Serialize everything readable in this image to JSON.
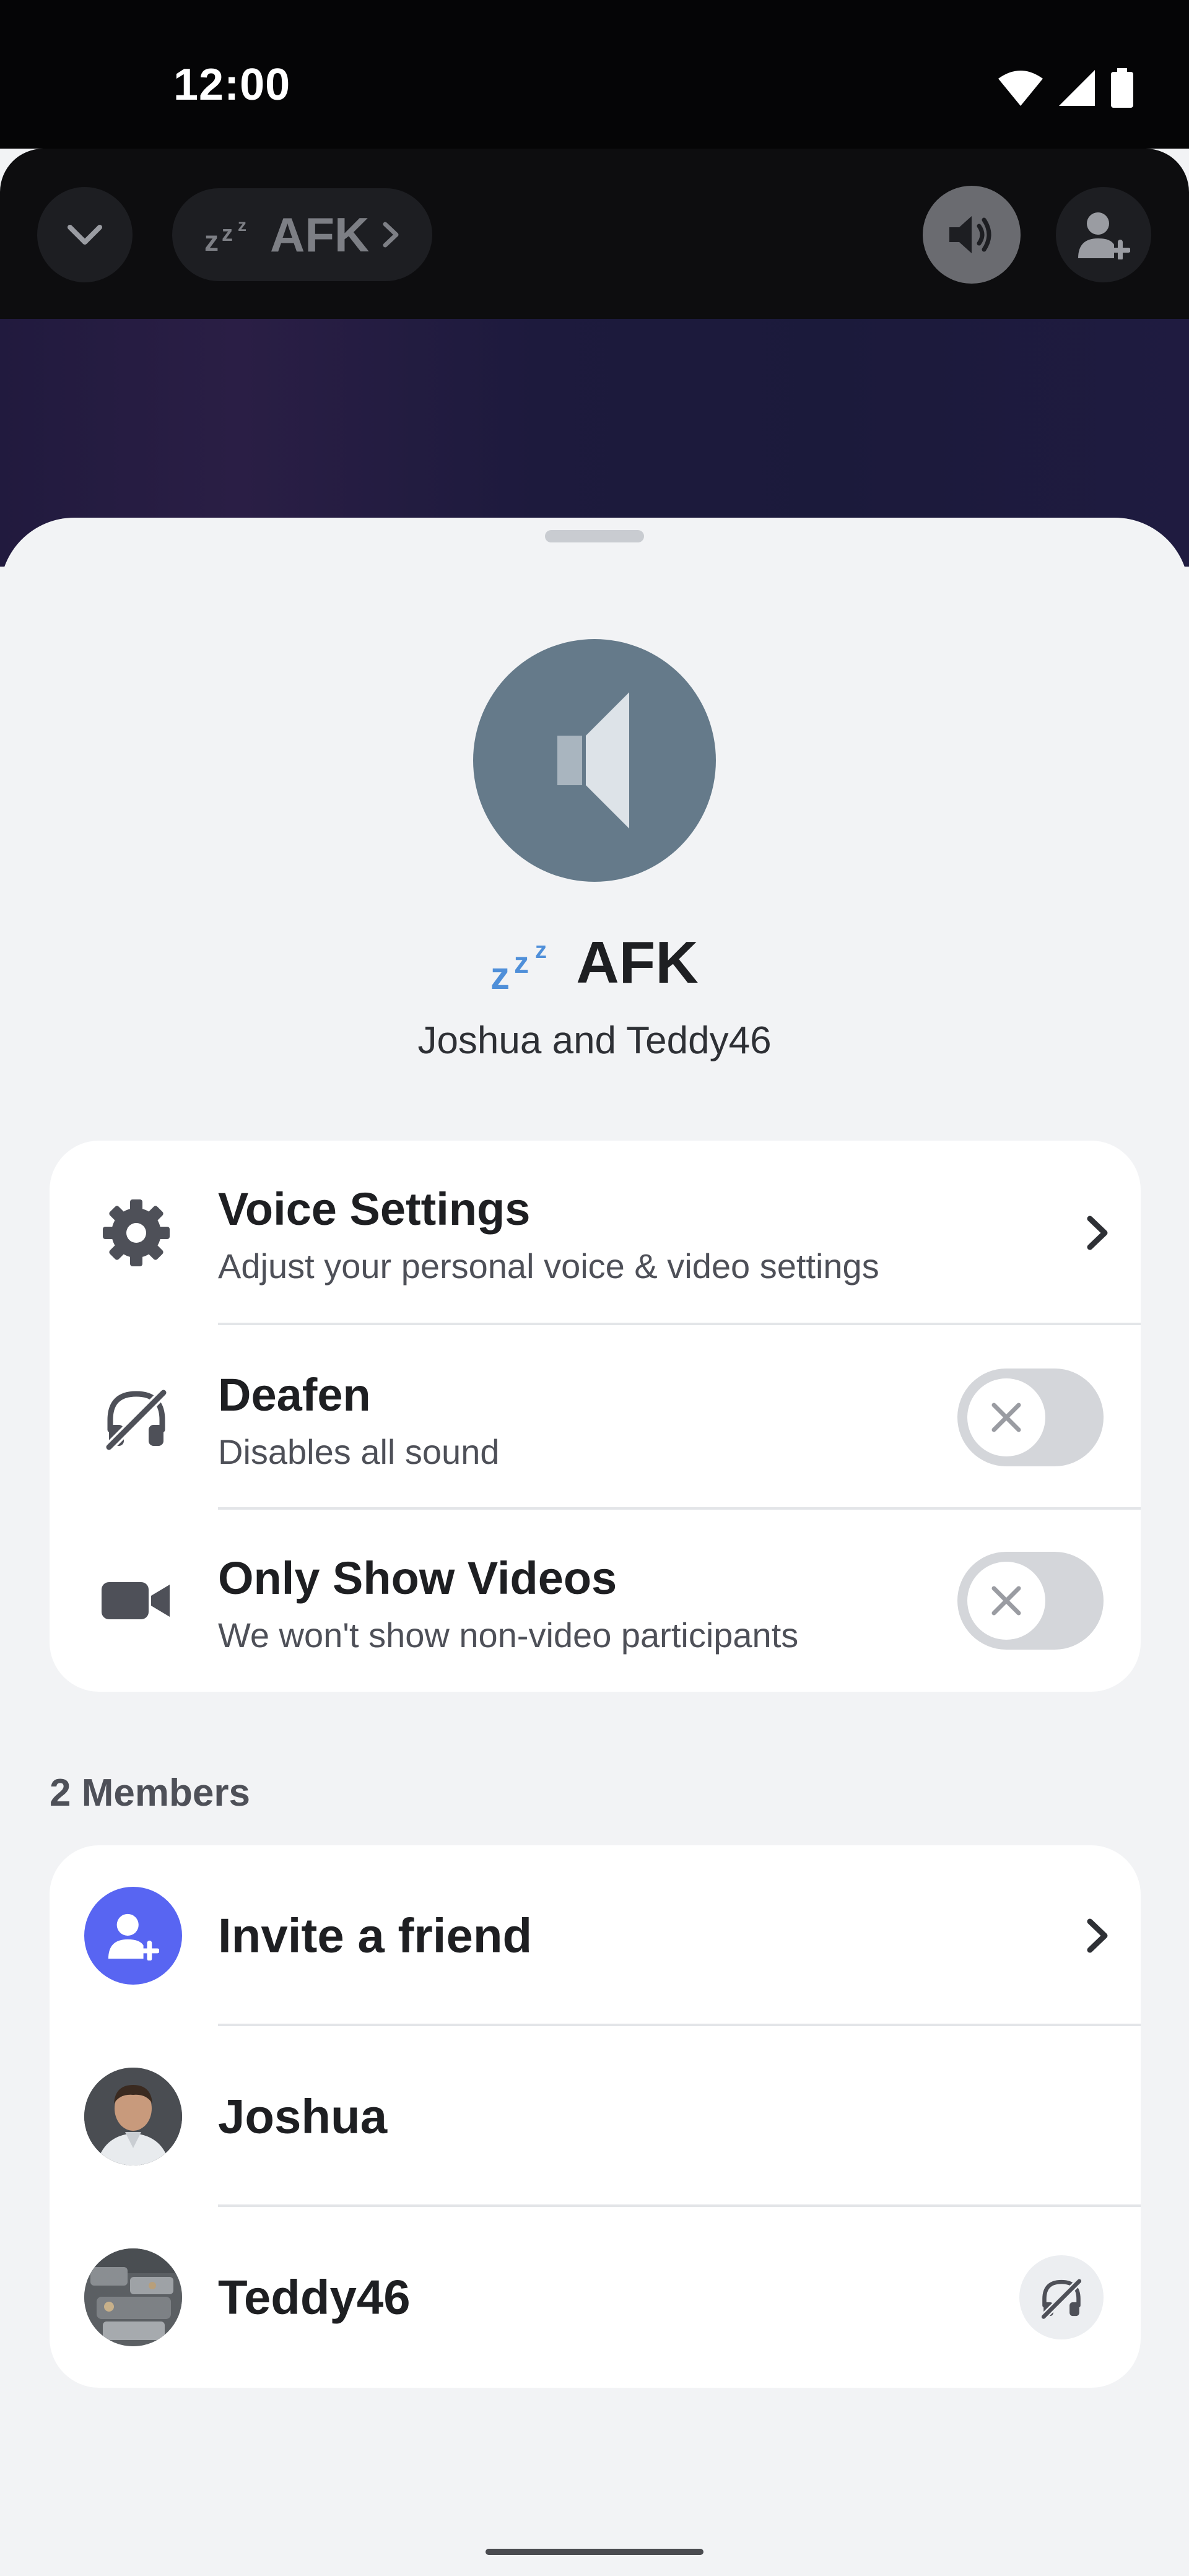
{
  "status_bar": {
    "time": "12:00",
    "icons": [
      "wifi-icon",
      "signal-icon",
      "battery-icon"
    ]
  },
  "call_header": {
    "collapse_icon": "chevron-down-icon",
    "channel_emoji": "zzz-icon",
    "channel_name": "AFK",
    "speaker_icon": "speaker-icon",
    "add_user_icon": "add-user-icon"
  },
  "sheet": {
    "channel": {
      "emoji": "zzz-icon",
      "name": "AFK",
      "participants_text": "Joshua and Teddy46"
    },
    "settings": [
      {
        "icon": "gear-icon",
        "title": "Voice Settings",
        "description": "Adjust your personal voice & video settings",
        "control": "chevron"
      },
      {
        "icon": "deafen-icon",
        "title": "Deafen",
        "description": "Disables all sound",
        "control": "toggle",
        "enabled": false
      },
      {
        "icon": "video-camera-icon",
        "title": "Only Show Videos",
        "description": "We won't show non-video participants",
        "control": "toggle",
        "enabled": false
      }
    ],
    "members_label": "2 Members",
    "invite_label": "Invite a friend",
    "members": [
      {
        "name": "Joshua",
        "avatar": "avatar-joshua"
      },
      {
        "name": "Teddy46",
        "avatar": "avatar-teddy46",
        "status_icon": "deafened-icon"
      }
    ]
  },
  "colors": {
    "accent": "#5865f2",
    "channel_avatar": "#657a8a",
    "toggle_off": "#d4d6da",
    "sheet_bg": "#f2f3f5"
  }
}
